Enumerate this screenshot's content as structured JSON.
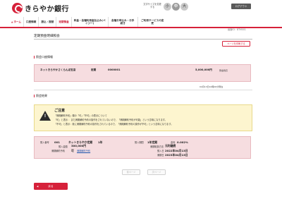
{
  "header": {
    "bank_name": "きらやか銀行",
    "font_size_label": "文字サイズを変更する",
    "font_sizes": [
      "小",
      "中",
      "大"
    ],
    "logout_label": "ログアウト"
  },
  "nav": {
    "items": [
      {
        "label": "ホーム"
      },
      {
        "label": "口座情報"
      },
      {
        "label": "振込・振替"
      },
      {
        "label": "定期預金"
      },
      {
        "label": "料金・各種利用金払込み(ペイジー)"
      },
      {
        "label": "各種お申込み・お手続き"
      },
      {
        "label": "ご利用サービスの変更"
      }
    ]
  },
  "screen_id": "画面ID：BTM001",
  "page_title": "定期預金明細照会",
  "print_label": "ページを印刷する",
  "account_section": {
    "title": "照会口座情報",
    "holder": "ネットきらやかさくらんぼ支店",
    "type": "定期",
    "number": "0000001",
    "balance": "5,000,000円",
    "balance_note": "預金残高"
  },
  "as_of": "04月13日10時00分現在",
  "result_section": {
    "title": "照会結果"
  },
  "notice": {
    "title": "ご注意",
    "lines": [
      "「満期解約予約」欄の「可」「不可」の表示について",
      "「可」と表示 ：まだ満期解約予約の操作をされていないので、「満期解約予約が可能」という意味になります。",
      "「不可」と表示：既に満期解約予約の操作をされているので、「満期解約予約の操作が不可」という意味になります。"
    ]
  },
  "deposit": {
    "no_label": "預入番号",
    "no": "001",
    "name": "ネットきらやか定期",
    "term": "1年",
    "term_label": "預入期間",
    "term_value": "1年定期",
    "rate_label": "金利",
    "rate": "0.002%",
    "amount_label": "預入金額",
    "amount": "300,000円",
    "maturity_method_label": "満期取扱方法",
    "maturity_method": "元利継続",
    "reservation_label": "満期解約予約",
    "reservation": "可",
    "reservation_link": "満期解約予約",
    "deposit_date_label": "預入日",
    "deposit_date": "2022年04月13日",
    "maturity_date_label": "満期日",
    "maturity_date": "2023年04月13日"
  },
  "pager": {
    "prev": "前ページ",
    "next": "次ページ"
  },
  "back_label": "戻る",
  "colors": {
    "brand_red": "#d6213a",
    "pink_panel": "#f6dde0",
    "notice_yellow": "#fdf5cf"
  }
}
